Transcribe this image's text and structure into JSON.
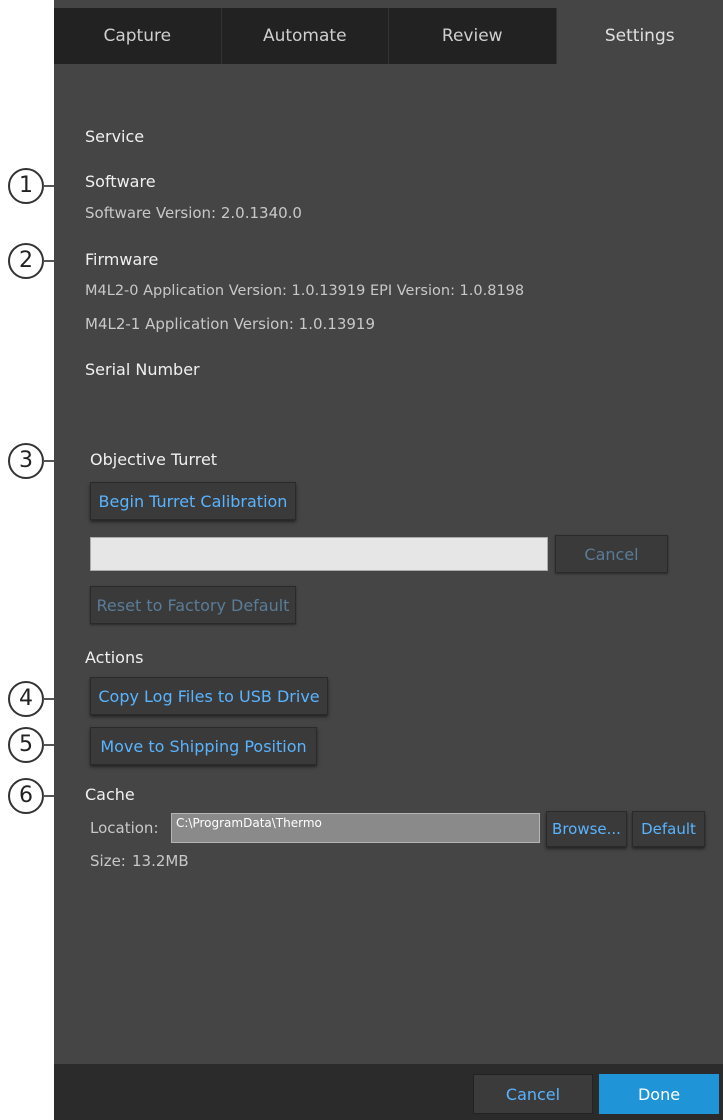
{
  "tabs": [
    {
      "label": "Capture"
    },
    {
      "label": "Automate"
    },
    {
      "label": "Review"
    },
    {
      "label": "Settings"
    }
  ],
  "callouts": [
    "1",
    "2",
    "3",
    "4",
    "5",
    "6"
  ],
  "service": {
    "heading": "Service",
    "software_label": "Software",
    "software_version": "Software Version: 2.0.1340.0",
    "firmware_label": "Firmware",
    "firmware_line1": "M4L2-0  Application Version: 1.0.13919  EPI Version: 1.0.8198",
    "firmware_line2": "M4L2-1  Application Version: 1.0.13919",
    "serial_number_label": "Serial Number"
  },
  "turret": {
    "heading": "Objective Turret",
    "calibrate_button": "Begin Turret Calibration",
    "cancel_button": "Cancel",
    "reset_button": "Reset to Factory Default"
  },
  "actions": {
    "heading": "Actions",
    "copy_logs_button": "Copy Log Files to USB Drive",
    "shipping_button": "Move to Shipping Position"
  },
  "cache": {
    "heading": "Cache",
    "location_label": "Location:",
    "location_value": "C:\\ProgramData\\Thermo",
    "browse_button": "Browse...",
    "default_button": "Default",
    "size_label": "Size:",
    "size_value": "13.2MB"
  },
  "footer": {
    "cancel_button": "Cancel",
    "done_button": "Done"
  },
  "colors": {
    "panel_bg": "#454545",
    "tab_bar_bg": "#222222",
    "accent_text": "#59b4ff",
    "done_button_bg": "#1f95d8"
  }
}
